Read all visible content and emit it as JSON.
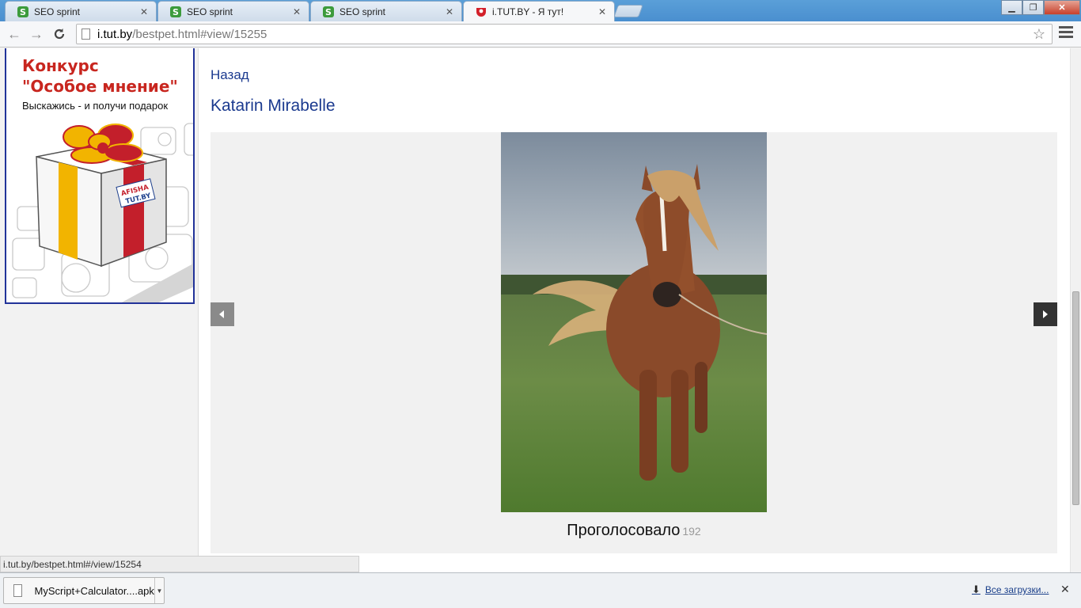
{
  "browser": {
    "tabs": [
      {
        "title": "SEO sprint",
        "favicon": "seo-sprint-icon",
        "active": false
      },
      {
        "title": "SEO sprint",
        "favicon": "seo-sprint-icon",
        "active": false
      },
      {
        "title": "SEO sprint",
        "favicon": "seo-sprint-icon",
        "active": false
      },
      {
        "title": "i.TUT.BY - Я тут!",
        "favicon": "itutby-icon",
        "active": true
      }
    ],
    "url_host": "i.tut.by",
    "url_path": "/bestpet.html#view/15255"
  },
  "promo": {
    "title_line1": "Конкурс",
    "title_line2": "\"Особое мнение\"",
    "subtitle": "Выскажись - и получи подарок",
    "box_label_1": "AFISHA",
    "box_label_2": "TUT.BY"
  },
  "main": {
    "back_label": "Назад",
    "pet_name": "Katarin Mirabelle",
    "votes_label": "Проголосовало",
    "votes_count": "192"
  },
  "status_url": "i.tut.by/bestpet.html#/view/15254",
  "downloads": {
    "file_name": "MyScript+Calculator....apk",
    "all_label": "Все загрузки..."
  },
  "colors": {
    "accent_link": "#1b3a8f",
    "promo_red": "#c8261f",
    "promo_border": "#223399"
  }
}
